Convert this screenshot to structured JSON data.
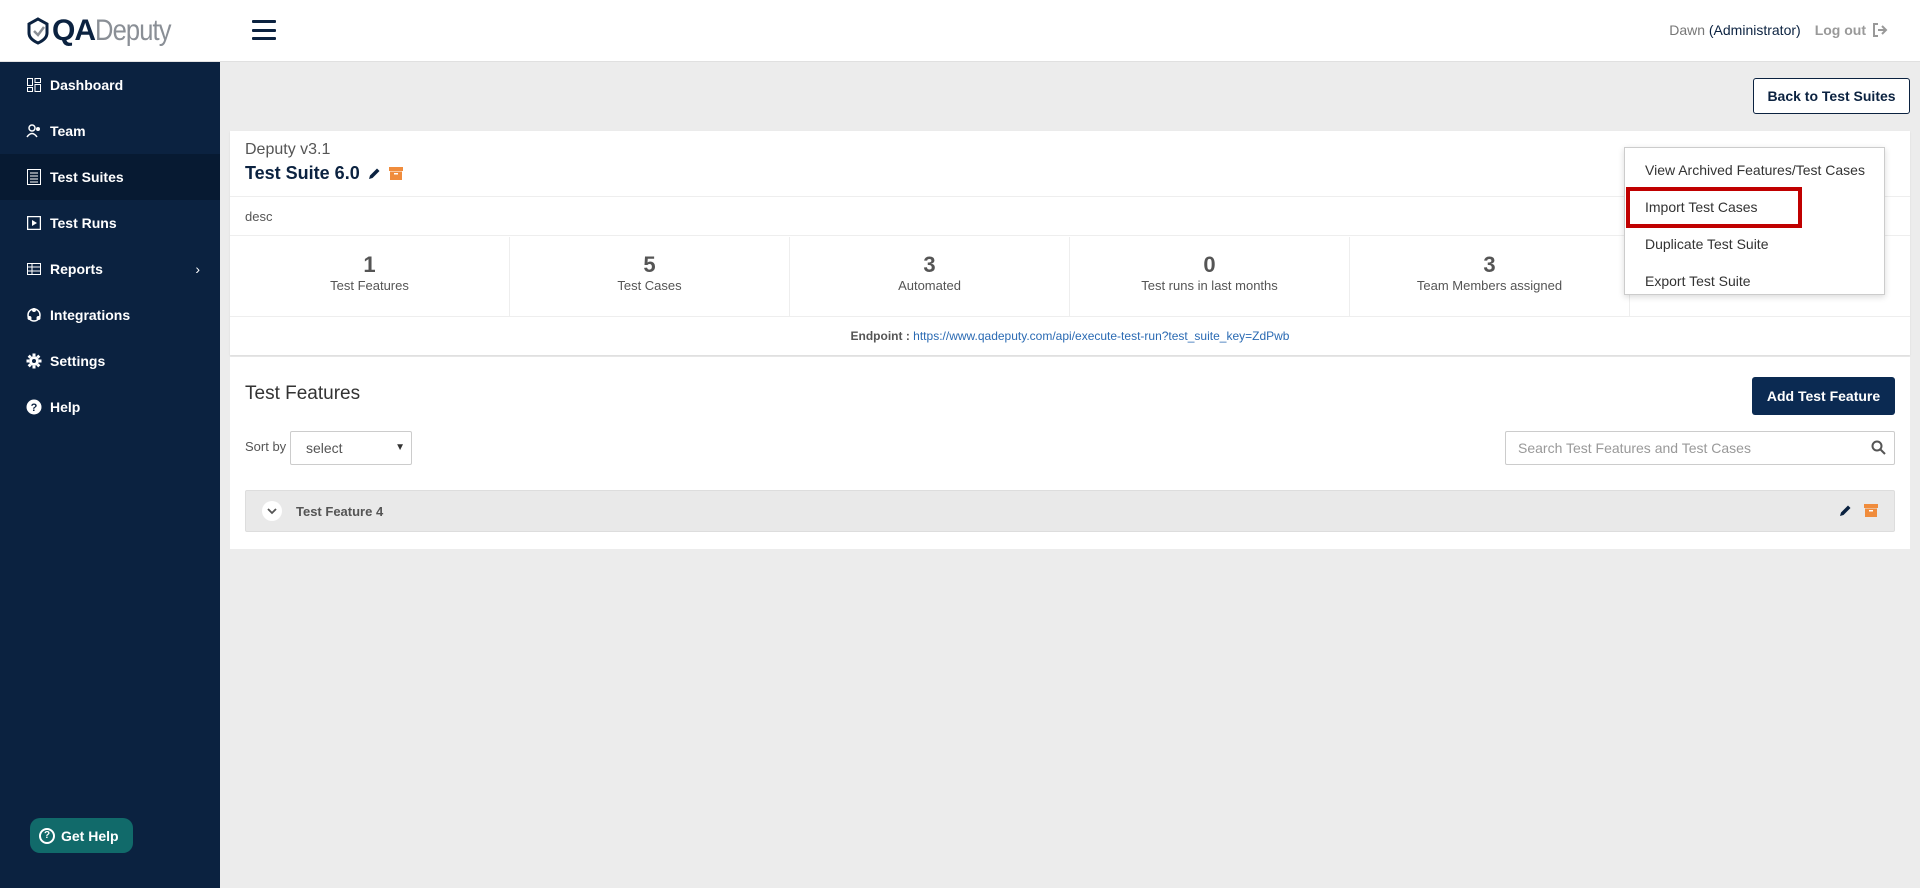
{
  "logo": {
    "part1": "QA",
    "part2": "Deputy"
  },
  "sidebar": {
    "items": [
      {
        "label": "Dashboard",
        "icon": "grid-icon"
      },
      {
        "label": "Team",
        "icon": "users-icon"
      },
      {
        "label": "Test Suites",
        "icon": "list-icon"
      },
      {
        "label": "Test Runs",
        "icon": "play-icon"
      },
      {
        "label": "Reports",
        "icon": "table-icon"
      },
      {
        "label": "Integrations",
        "icon": "integrations-icon"
      },
      {
        "label": "Settings",
        "icon": "gear-icon"
      },
      {
        "label": "Help",
        "icon": "help-icon"
      }
    ],
    "active": "Test Suites",
    "get_help": "Get Help"
  },
  "header": {
    "user_name": "Dawn",
    "user_role": "(Administrator)",
    "logout": "Log out"
  },
  "main": {
    "back_button": "Back to Test Suites",
    "project_name": "Deputy v3.1",
    "suite_name": "Test Suite 6.0",
    "description": "desc",
    "stats": [
      {
        "value": "1",
        "label": "Test Features"
      },
      {
        "value": "5",
        "label": "Test Cases"
      },
      {
        "value": "3",
        "label": "Automated"
      },
      {
        "value": "0",
        "label": "Test runs in last months"
      },
      {
        "value": "3",
        "label": "Team Members assigned"
      }
    ],
    "endpoint_label": "Endpoint :",
    "endpoint_url": "https://www.qadeputy.com/api/execute-test-run?test_suite_key=ZdPwb"
  },
  "dropdown": {
    "items": [
      "View Archived Features/Test Cases",
      "Import Test Cases",
      "Duplicate Test Suite",
      "Export Test Suite"
    ],
    "highlighted": "Import Test Cases",
    "highlight_color": "#c00000"
  },
  "features": {
    "title": "Test Features",
    "add_button": "Add Test Feature",
    "sort_label": "Sort by",
    "sort_value": "select",
    "search_placeholder": "Search Test Features and Test Cases",
    "rows": [
      {
        "name": "Test Feature 4"
      }
    ]
  },
  "colors": {
    "navy": "#0b2240",
    "accent_orange": "#f08c3c",
    "link": "#2a6ab3"
  }
}
